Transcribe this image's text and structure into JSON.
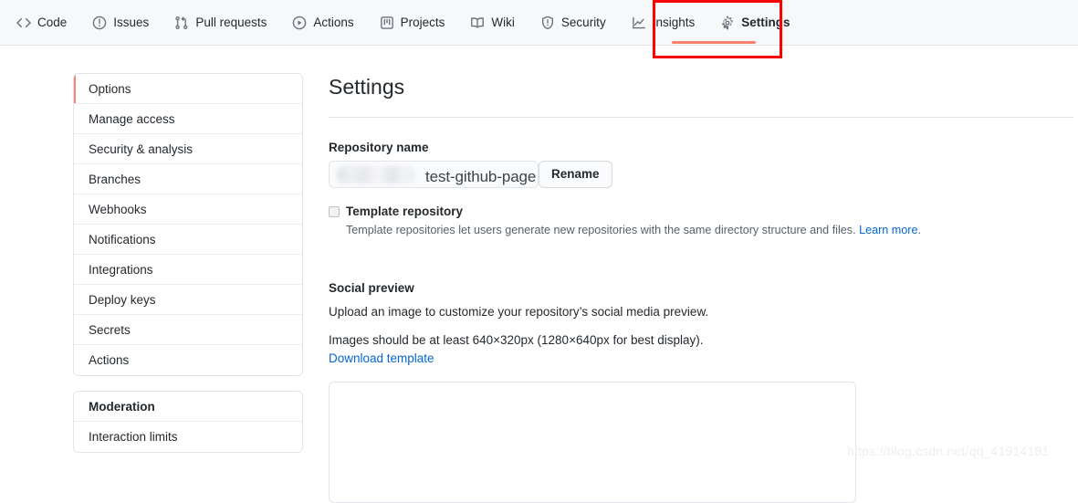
{
  "repo_nav": {
    "tabs": [
      {
        "label": "Code",
        "icon": "code-icon",
        "selected": false
      },
      {
        "label": "Issues",
        "icon": "issue-opened-icon",
        "selected": false
      },
      {
        "label": "Pull requests",
        "icon": "git-pull-request-icon",
        "selected": false
      },
      {
        "label": "Actions",
        "icon": "play-icon",
        "selected": false
      },
      {
        "label": "Projects",
        "icon": "project-icon",
        "selected": false
      },
      {
        "label": "Wiki",
        "icon": "book-icon",
        "selected": false
      },
      {
        "label": "Security",
        "icon": "shield-icon",
        "selected": false
      },
      {
        "label": "Insights",
        "icon": "graph-icon",
        "selected": false
      },
      {
        "label": "Settings",
        "icon": "gear-icon",
        "selected": true
      }
    ],
    "selected_tab": "Settings",
    "underline_color": "#f9826c",
    "background_color": "#f6f8fa"
  },
  "annotation": {
    "shape": "rectangle",
    "color": "#ff0000",
    "targets": "Settings"
  },
  "sidebar": {
    "groups": [
      {
        "items": [
          {
            "label": "Options",
            "selected": true
          },
          {
            "label": "Manage access",
            "selected": false
          },
          {
            "label": "Security & analysis",
            "selected": false
          },
          {
            "label": "Branches",
            "selected": false
          },
          {
            "label": "Webhooks",
            "selected": false
          },
          {
            "label": "Notifications",
            "selected": false
          },
          {
            "label": "Integrations",
            "selected": false
          },
          {
            "label": "Deploy keys",
            "selected": false
          },
          {
            "label": "Secrets",
            "selected": false
          },
          {
            "label": "Actions",
            "selected": false
          }
        ]
      },
      {
        "items": [
          {
            "label": "Moderation",
            "heading": true
          },
          {
            "label": "Interaction limits",
            "heading": false
          }
        ]
      }
    ]
  },
  "main": {
    "title": "Settings",
    "repository_name": {
      "label": "Repository name",
      "value": "",
      "redacted": true,
      "overlay_text": "test-github-page",
      "rename_button": "Rename"
    },
    "template_repository": {
      "label": "Template repository",
      "checked": false,
      "description": "Template repositories let users generate new repositories with the same directory structure and files.",
      "link_text": "Learn more",
      "link_suffix": "."
    },
    "social_preview": {
      "title": "Social preview",
      "description": "Upload an image to customize your repository’s social media preview.",
      "size_note": "Images should be at least 640×320px (1280×640px for best display).",
      "download_link": "Download template"
    }
  },
  "watermark": "https://blog.csdn.net/qq_41914181"
}
